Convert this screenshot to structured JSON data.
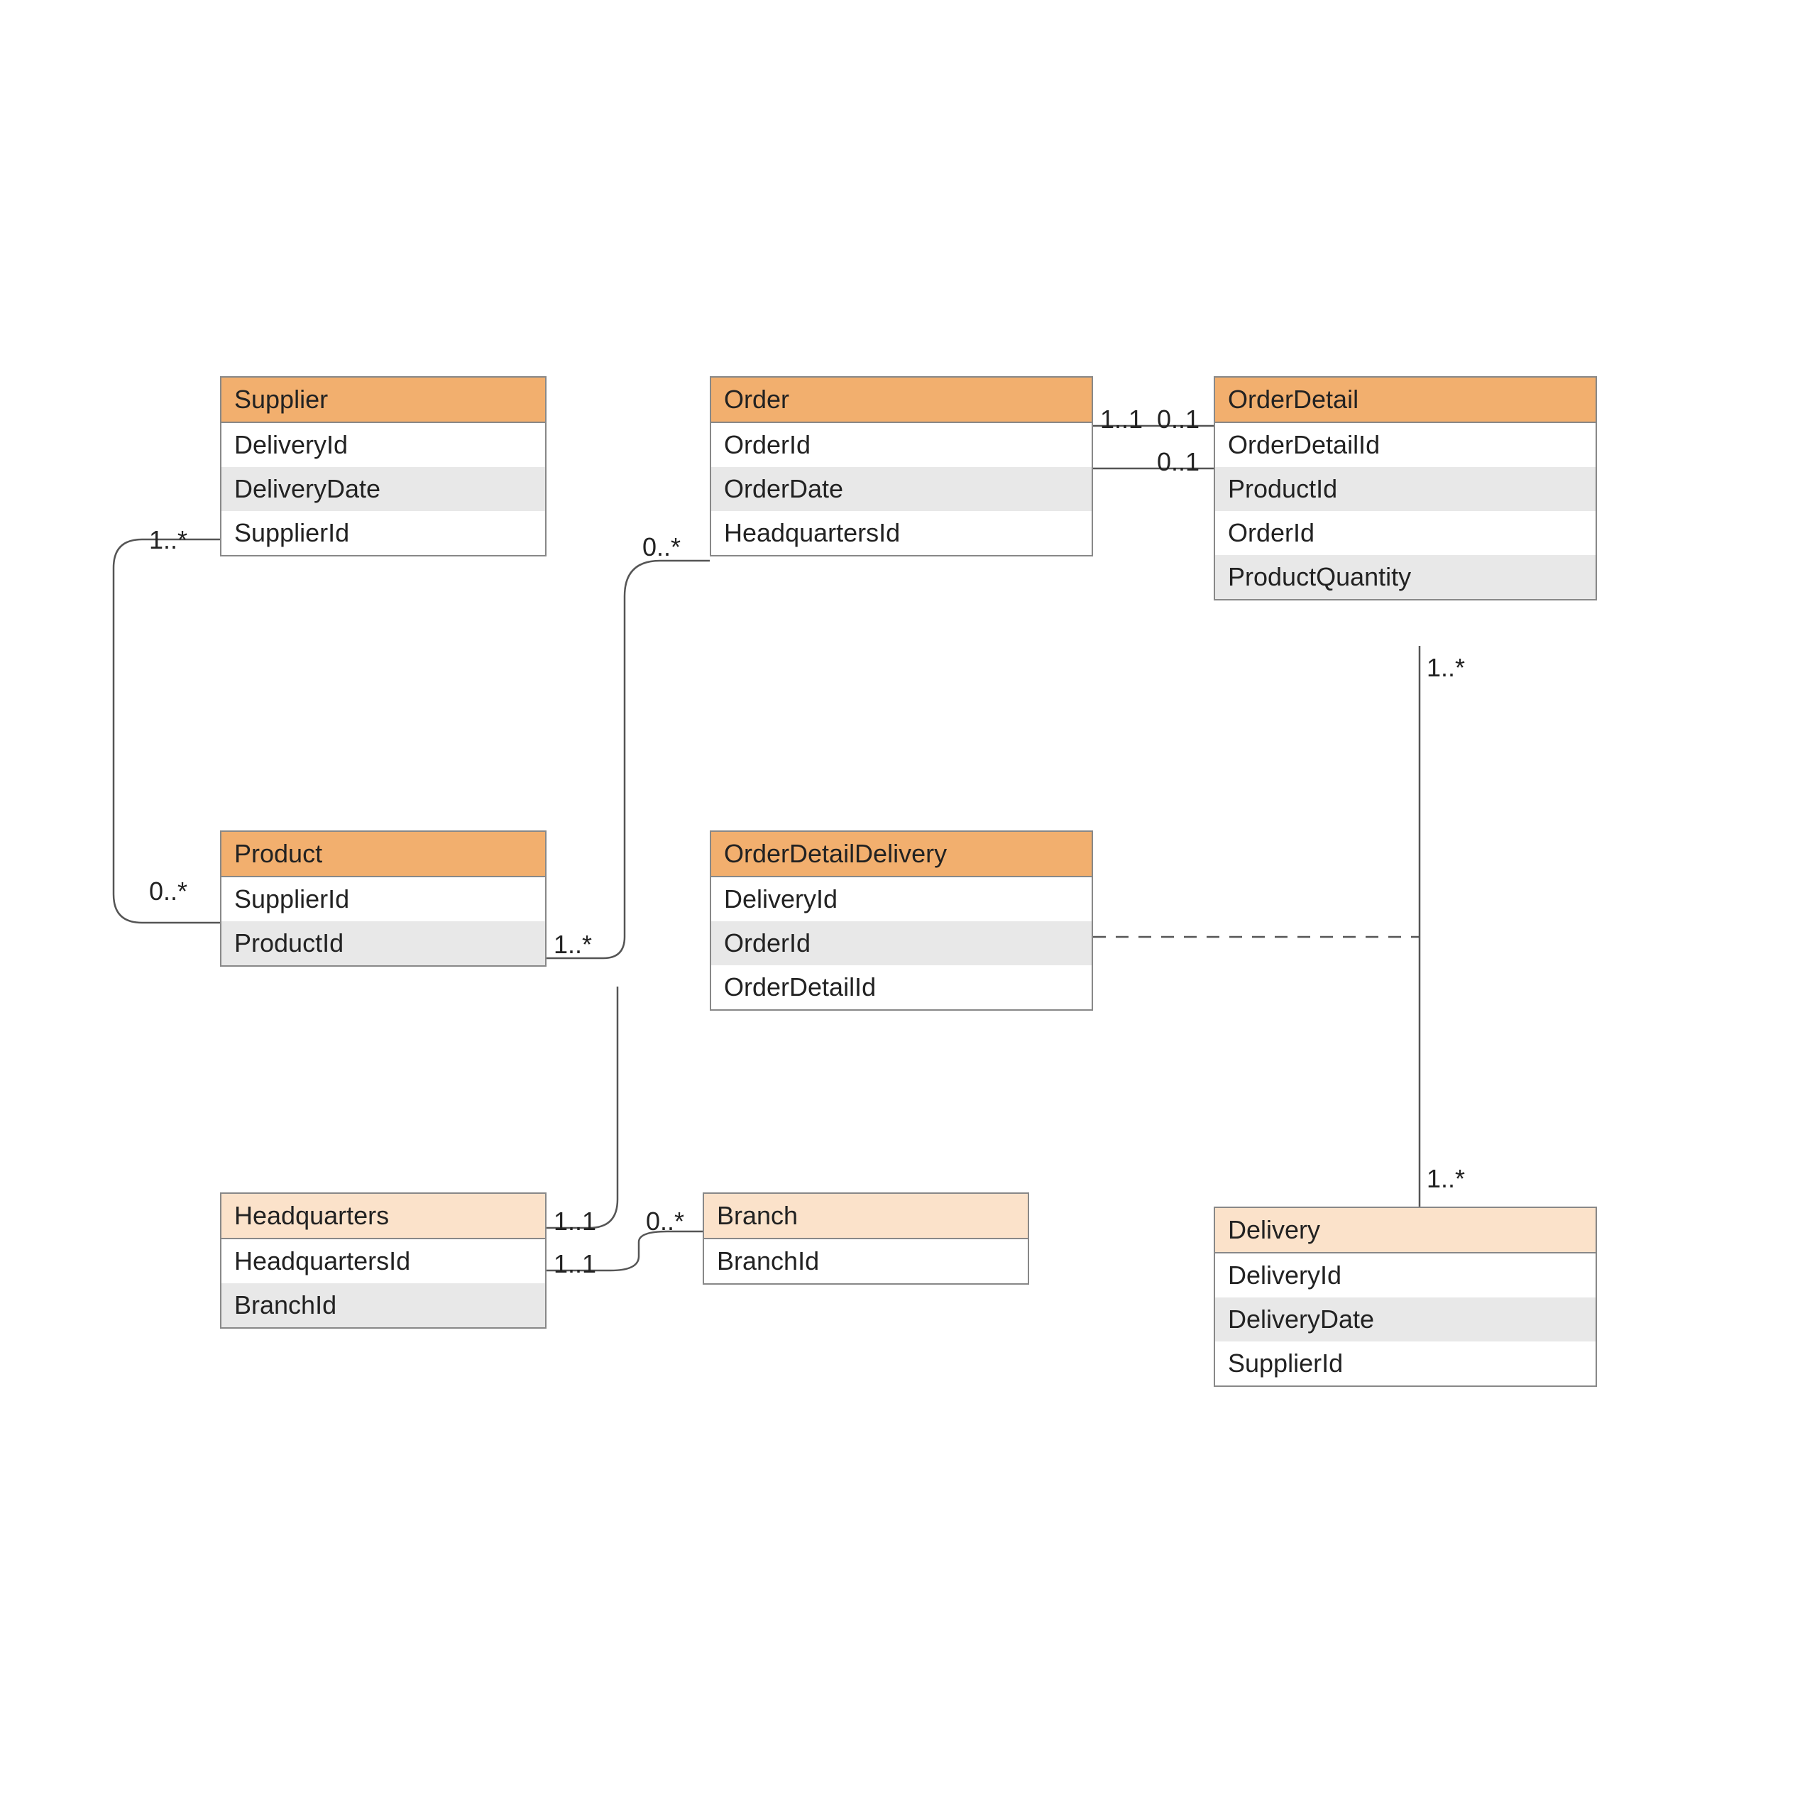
{
  "entities": {
    "supplier": {
      "title": "Supplier",
      "attrs": [
        "DeliveryId",
        "DeliveryDate",
        "SupplierId"
      ]
    },
    "order": {
      "title": "Order",
      "attrs": [
        "OrderId",
        "OrderDate",
        "HeadquartersId"
      ]
    },
    "orderDetail": {
      "title": "OrderDetail",
      "attrs": [
        "OrderDetailId",
        "ProductId",
        "OrderId",
        "ProductQuantity"
      ]
    },
    "product": {
      "title": "Product",
      "attrs": [
        "SupplierId",
        "ProductId"
      ]
    },
    "orderDetailDelivery": {
      "title": "OrderDetailDelivery",
      "attrs": [
        "DeliveryId",
        "OrderId",
        "OrderDetailId"
      ]
    },
    "headquarters": {
      "title": "Headquarters",
      "attrs": [
        "HeadquartersId",
        "BranchId"
      ]
    },
    "branch": {
      "title": "Branch",
      "attrs": [
        "BranchId"
      ]
    },
    "delivery": {
      "title": "Delivery",
      "attrs": [
        "DeliveryId",
        "DeliveryDate",
        "SupplierId"
      ]
    }
  },
  "labels": {
    "supplierLeft": "1..*",
    "productLeft": "0..*",
    "productRight": "1..*",
    "orderLeft": "0..*",
    "orderRight": "1..1",
    "orderDetailTop1": "0..1",
    "orderDetailTop2": "0..1",
    "hqRight1": "1..1",
    "hqRight2": "1..1",
    "branchLeft": "0..*",
    "odUnder": "1..*",
    "deliveryOver": "1..*"
  }
}
